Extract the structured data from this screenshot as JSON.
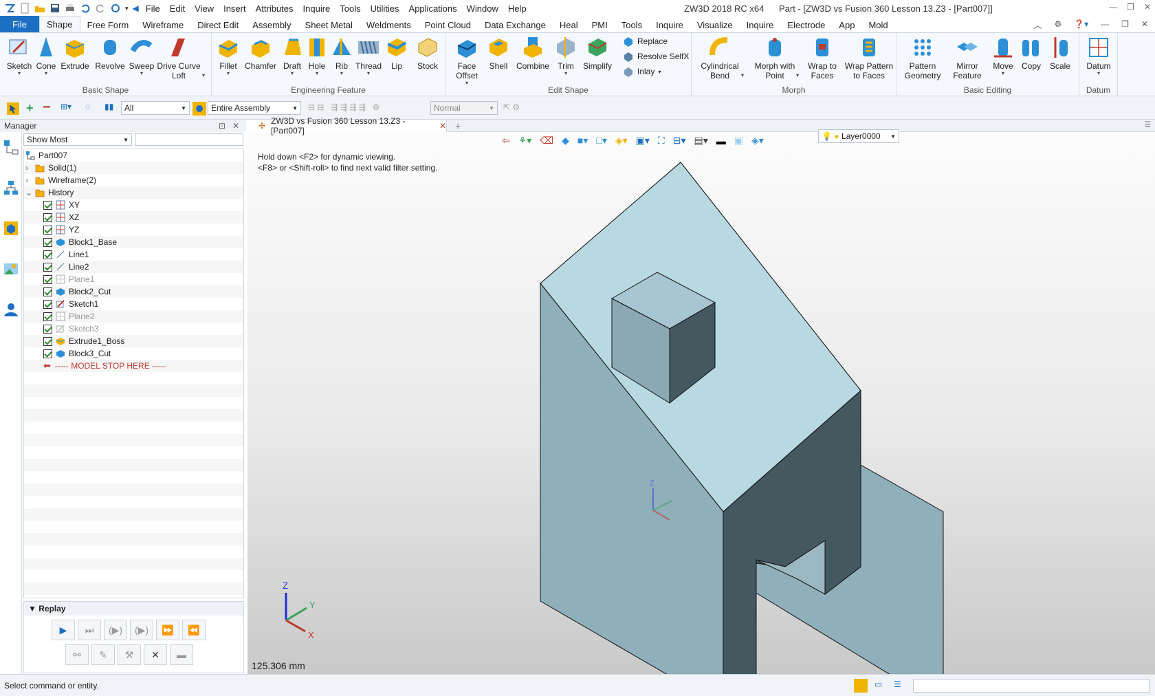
{
  "app": {
    "title": "ZW3D 2018 RC x64",
    "doc_title": "Part - [ZW3D vs Fusion 360 Lesson 13.Z3 - [Part007]]"
  },
  "menu": [
    "File",
    "Edit",
    "View",
    "Insert",
    "Attributes",
    "Inquire",
    "Tools",
    "Utilities",
    "Applications",
    "Window",
    "Help"
  ],
  "ribbon_tabs": {
    "file": "File",
    "tabs": [
      "Shape",
      "Free Form",
      "Wireframe",
      "Direct Edit",
      "Assembly",
      "Sheet Metal",
      "Weldments",
      "Point Cloud",
      "Data Exchange",
      "Heal",
      "PMI",
      "Tools",
      "Inquire",
      "Visualize",
      "Inquire",
      "Electrode",
      "App",
      "Mold"
    ],
    "active": "Shape"
  },
  "ribbon": {
    "basic_shape": {
      "label": "Basic Shape",
      "buttons": [
        "Sketch",
        "Cone",
        "Extrude",
        "Revolve",
        "Sweep",
        "Drive Curve Loft"
      ]
    },
    "engineering": {
      "label": "Engineering Feature",
      "buttons": [
        "Fillet",
        "Chamfer",
        "Draft",
        "Hole",
        "Rib",
        "Thread",
        "Lip",
        "Stock"
      ]
    },
    "edit_shape": {
      "label": "Edit Shape",
      "buttons": [
        "Face Offset",
        "Shell",
        "Combine",
        "Trim",
        "Simplify"
      ],
      "small": [
        "Replace",
        "Resolve SelfX",
        "Inlay"
      ]
    },
    "morph": {
      "label": "Morph",
      "buttons": [
        "Cylindrical Bend",
        "Morph with Point",
        "Wrap to Faces",
        "Wrap Pattern to Faces"
      ]
    },
    "basic_editing": {
      "label": "Basic Editing",
      "buttons": [
        "Pattern Geometry",
        "Mirror Feature",
        "Move",
        "Copy",
        "Scale"
      ]
    },
    "datum": {
      "label": "Datum",
      "buttons": [
        "Datum"
      ]
    }
  },
  "toolbar2": {
    "filter": "All",
    "scope": "Entire Assembly",
    "mode": "Normal"
  },
  "manager": {
    "title": "Manager",
    "show": "Show Most",
    "tree": {
      "root": "Part007",
      "groups": [
        "Solid(1)",
        "Wireframe(2)",
        "History"
      ],
      "history": [
        {
          "name": "XY",
          "enabled": true
        },
        {
          "name": "XZ",
          "enabled": true
        },
        {
          "name": "YZ",
          "enabled": true
        },
        {
          "name": "Block1_Base",
          "enabled": true
        },
        {
          "name": "Line1",
          "enabled": true
        },
        {
          "name": "Line2",
          "enabled": true
        },
        {
          "name": "Plane1",
          "enabled": false
        },
        {
          "name": "Block2_Cut",
          "enabled": true
        },
        {
          "name": "Sketch1",
          "enabled": true
        },
        {
          "name": "Plane2",
          "enabled": false
        },
        {
          "name": "Sketch3",
          "enabled": false
        },
        {
          "name": "Extrude1_Boss",
          "enabled": true
        },
        {
          "name": "Block3_Cut",
          "enabled": true
        }
      ],
      "stop": "----- MODEL STOP HERE -----"
    },
    "replay": "Replay"
  },
  "viewport": {
    "doc_tab": "ZW3D vs Fusion 360 Lesson 13.Z3 - [Part007]",
    "hint1": "Hold down <F2> for dynamic viewing.",
    "hint2": "<F8> or <Shift-roll> to find next valid filter setting.",
    "layer": "Layer0000",
    "scale": "125.306 mm",
    "axes": {
      "x": "X",
      "y": "Y",
      "z": "Z"
    }
  },
  "status": {
    "text": "Select command or entity."
  },
  "colors": {
    "accent": "#1d6fc3",
    "model_top": "#b8d8e2",
    "model_left": "#8fafba",
    "model_right": "#445860"
  }
}
